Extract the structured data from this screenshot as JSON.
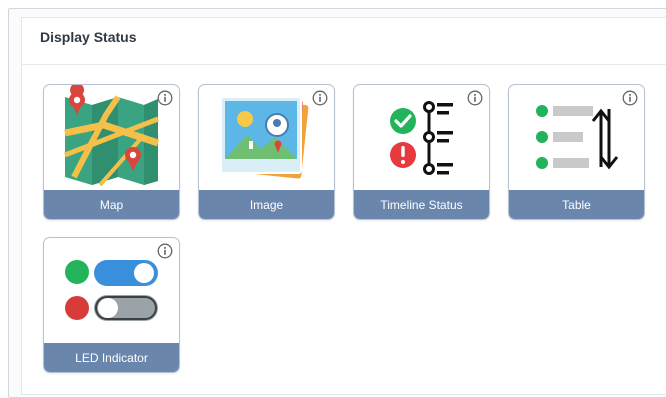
{
  "panel": {
    "title": "Display Status"
  },
  "tiles": [
    {
      "label": "Map",
      "icon": "map-icon"
    },
    {
      "label": "Image",
      "icon": "image-icon"
    },
    {
      "label": "Timeline Status",
      "icon": "timeline-status-icon"
    },
    {
      "label": "Table",
      "icon": "table-icon"
    },
    {
      "label": "LED Indicator",
      "icon": "led-indicator-icon"
    }
  ],
  "colors": {
    "label_bar": "#6a86ad",
    "tile_border": "#b6c2d1",
    "green": "#22b35b",
    "red": "#e63a3e",
    "toggle_on": "#3a8fdc",
    "toggle_off": "#9aa3a8"
  }
}
